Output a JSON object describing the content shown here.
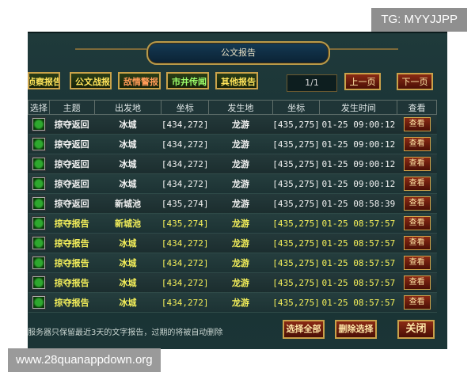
{
  "watermarks": {
    "top": "TG: MYYJJPP",
    "bottom": "www.28quanappdown.org"
  },
  "panel": {
    "title": "公文报告"
  },
  "categories": [
    "侦察报告",
    "公文战报",
    "敌情警报",
    "市井传闻",
    "其他报告"
  ],
  "pagination": {
    "page": "1/1",
    "prev_label": "上一页",
    "next_label": "下一页"
  },
  "columns": [
    "选择",
    "主题",
    "出发地",
    "坐标",
    "发生地",
    "坐标",
    "发生时间",
    "查看"
  ],
  "rows": [
    {
      "subject": "掠夺返回",
      "origin": "冰城",
      "origin_coord": "[434,272]",
      "dest": "龙游",
      "dest_coord": "[435,275]",
      "time": "01-25 09:00:12",
      "view": "查看",
      "color": "#f2f2f2"
    },
    {
      "subject": "掠夺返回",
      "origin": "冰城",
      "origin_coord": "[434,272]",
      "dest": "龙游",
      "dest_coord": "[435,275]",
      "time": "01-25 09:00:12",
      "view": "查看",
      "color": "#f2f2f2"
    },
    {
      "subject": "掠夺返回",
      "origin": "冰城",
      "origin_coord": "[434,272]",
      "dest": "龙游",
      "dest_coord": "[435,275]",
      "time": "01-25 09:00:12",
      "view": "查看",
      "color": "#f2f2f2"
    },
    {
      "subject": "掠夺返回",
      "origin": "冰城",
      "origin_coord": "[434,272]",
      "dest": "龙游",
      "dest_coord": "[435,275]",
      "time": "01-25 09:00:12",
      "view": "查看",
      "color": "#f2f2f2"
    },
    {
      "subject": "掠夺返回",
      "origin": "新城池",
      "origin_coord": "[435,274]",
      "dest": "龙游",
      "dest_coord": "[435,275]",
      "time": "01-25 08:58:39",
      "view": "查看",
      "color": "#f2f2f2"
    },
    {
      "subject": "掠夺报告",
      "origin": "新城池",
      "origin_coord": "[435,274]",
      "dest": "龙游",
      "dest_coord": "[435,275]",
      "time": "01-25 08:57:57",
      "view": "查看",
      "color": "#f5f05a"
    },
    {
      "subject": "掠夺报告",
      "origin": "冰城",
      "origin_coord": "[434,272]",
      "dest": "龙游",
      "dest_coord": "[435,275]",
      "time": "01-25 08:57:57",
      "view": "查看",
      "color": "#f5f05a"
    },
    {
      "subject": "掠夺报告",
      "origin": "冰城",
      "origin_coord": "[434,272]",
      "dest": "龙游",
      "dest_coord": "[435,275]",
      "time": "01-25 08:57:57",
      "view": "查看",
      "color": "#f5f05a"
    },
    {
      "subject": "掠夺报告",
      "origin": "冰城",
      "origin_coord": "[434,272]",
      "dest": "龙游",
      "dest_coord": "[435,275]",
      "time": "01-25 08:57:57",
      "view": "查看",
      "color": "#f5f05a"
    },
    {
      "subject": "掠夺报告",
      "origin": "冰城",
      "origin_coord": "[434,272]",
      "dest": "龙游",
      "dest_coord": "[435,275]",
      "time": "01-25 08:57:57",
      "view": "查看",
      "color": "#f5f05a"
    }
  ],
  "footer": {
    "note": "服务器只保留最近3天的文字报告，过期的将被自动删除",
    "select_all": "选择全部",
    "delete_selected": "删除选择",
    "close": "关闭"
  }
}
